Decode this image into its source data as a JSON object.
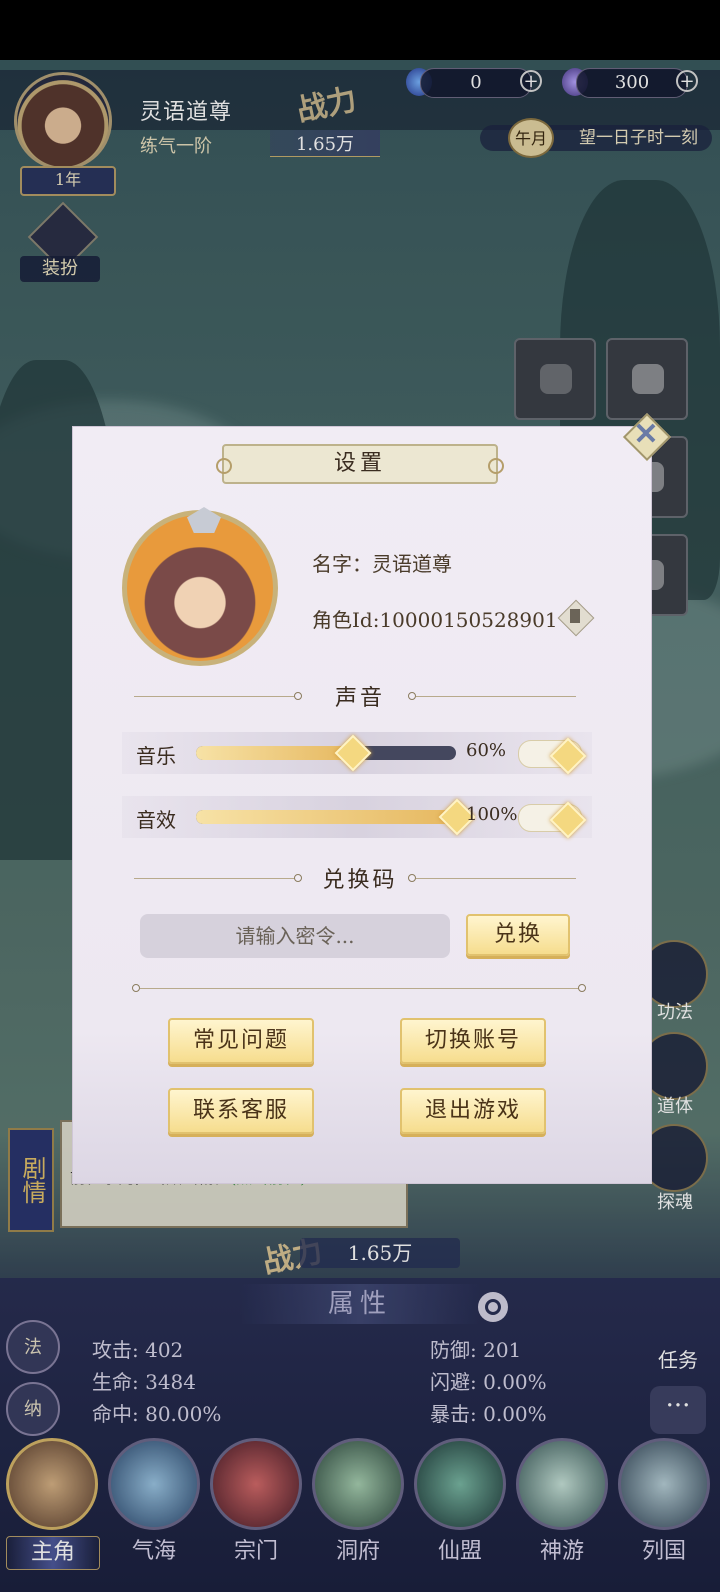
{
  "hud": {
    "player_name": "灵语道尊",
    "realm": "练气一阶",
    "power": "1.65万",
    "power_glyph": "战力",
    "age_tag": "1年",
    "currency_1": "0",
    "currency_2": "300",
    "plus": "+",
    "time_badge": "午月",
    "time_text": "望一日子时一刻",
    "dress_label": "装扮"
  },
  "right_icons": [
    "功法",
    "道体",
    "探魂"
  ],
  "quest": {
    "tab_label": "剧情",
    "text": "前往宗门，击败山精。",
    "link": "(点击前往)"
  },
  "bottom_power": "1.65万",
  "attributes": {
    "title": "属性",
    "stats": [
      {
        "label": "攻击",
        "value": "402"
      },
      {
        "label": "生命",
        "value": "3484"
      },
      {
        "label": "命中",
        "value": "80.00%"
      },
      {
        "label": "防御",
        "value": "201"
      },
      {
        "label": "闪避",
        "value": "0.00%"
      },
      {
        "label": "暴击",
        "value": "0.00%"
      }
    ],
    "fa_label": "法",
    "na_label": "纳",
    "task_label": "任务",
    "chat_glyph": "···"
  },
  "nav": [
    {
      "label": "主角",
      "active": true,
      "color": "#b7864a"
    },
    {
      "label": "气海",
      "color": "#6fa6c9"
    },
    {
      "label": "宗门",
      "color": "#a84a4a"
    },
    {
      "label": "洞府",
      "color": "#7fa88a"
    },
    {
      "label": "仙盟",
      "color": "#4e8a7a"
    },
    {
      "label": "神游",
      "color": "#9ac6b8"
    },
    {
      "label": "列国",
      "color": "#8aa6b0"
    }
  ],
  "settings": {
    "title": "设置",
    "name_line": "名字：灵语道尊",
    "id_line": "角色Id:10000150528901",
    "sound_title": "声音",
    "music_label": "音乐",
    "music_value": 60,
    "music_pct": "60%",
    "sfx_label": "音效",
    "sfx_value": 100,
    "sfx_pct": "100%",
    "redeem_title": "兑换码",
    "redeem_placeholder": "请输入密令...",
    "redeem_button": "兑换",
    "faq_button": "常见问题",
    "switch_button": "切换账号",
    "contact_button": "联系客服",
    "exit_button": "退出游戏",
    "close_glyph": "✕"
  }
}
